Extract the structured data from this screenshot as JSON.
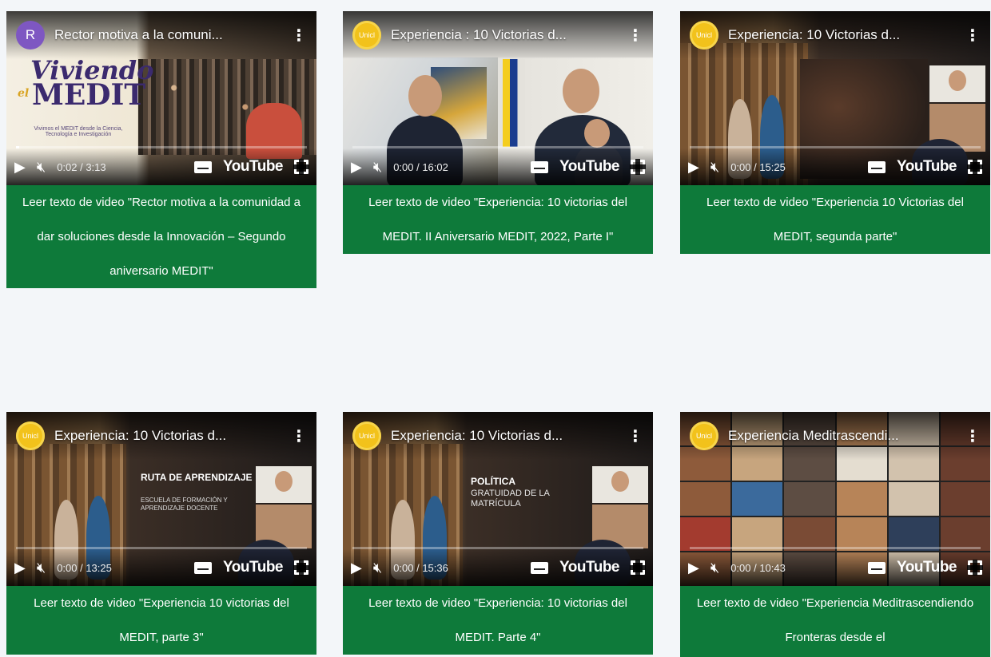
{
  "cards": [
    {
      "avatar_letter": "R",
      "avatar_type": "letter",
      "title": "Rector motiva a la comuni...",
      "time": "0:02 / 3:13",
      "progress": 0.01,
      "youtube": "YouTube",
      "caption": "Leer texto de video \"Rector motiva a la comunidad a dar soluciones desde la Innovación – Segundo aniversario MEDIT\"",
      "overlay": {
        "logo_line1": "Viviendo",
        "logo_line2": "MEDIT",
        "logo_el": "el",
        "sub": "Vivimos el MEDIT desde la Ciencia, Tecnología e Investigación"
      }
    },
    {
      "avatar_type": "sun",
      "avatar_label": "Unicl",
      "title": "Experiencia : 10 Victorias d...",
      "time": "0:00 / 16:02",
      "progress": 0,
      "youtube": "YouTube",
      "caption": "Leer texto de video \"Experiencia: 10 victorias del MEDIT. II Aniversario MEDIT, 2022, Parte I\""
    },
    {
      "avatar_type": "sun",
      "avatar_label": "Unicl",
      "title": "Experiencia: 10 Victorias d...",
      "time": "0:00 / 15:25",
      "progress": 0,
      "youtube": "YouTube",
      "caption": "Leer texto de video \"Experiencia 10 Victorias del MEDIT, segunda parte\""
    },
    {
      "avatar_type": "sun",
      "avatar_label": "Unicl",
      "title": "Experiencia: 10 Victorias d...",
      "time": "0:00 / 13:25",
      "progress": 0,
      "youtube": "YouTube",
      "caption": "Leer texto de video \"Experiencia 10 victorias del MEDIT, parte 3\"",
      "overlay": {
        "heading": "RUTA DE APRENDIZAJE",
        "sub": "ESCUELA DE FORMACIÓN Y APRENDIZAJE DOCENTE"
      }
    },
    {
      "avatar_type": "sun",
      "avatar_label": "Unicl",
      "title": "Experiencia: 10 Victorias d...",
      "time": "0:00 / 15:36",
      "progress": 0,
      "youtube": "YouTube",
      "caption": "Leer texto de video \"Experiencia: 10 victorias del MEDIT. Parte 4\"",
      "overlay": {
        "heading": "POLÍTICA",
        "sub": "GRATUIDAD DE LA MATRÍCULA"
      }
    },
    {
      "avatar_type": "sun",
      "avatar_label": "Unicl",
      "title": "Experiencia Meditrascendi...",
      "time": "0:00 / 10:43",
      "progress": 0,
      "youtube": "YouTube",
      "caption": "Leer texto de video \"Experiencia Meditrascendiendo Fronteras desde el"
    }
  ],
  "colors": {
    "caption_bg": "#0e7a3a",
    "page_bg": "#f3f6f9"
  }
}
